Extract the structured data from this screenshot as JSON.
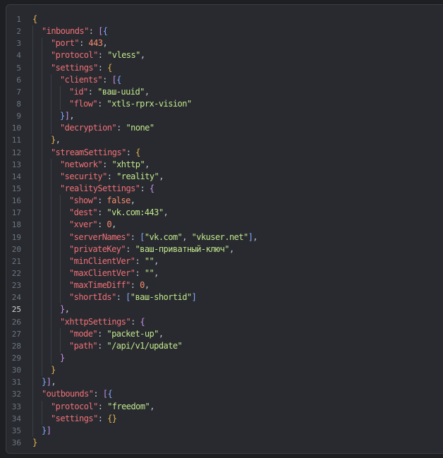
{
  "editor": {
    "language": "json",
    "active_line": 25,
    "colors": {
      "background": "#282a2f",
      "line_number": "#6e7681",
      "key": "#f07178",
      "string": "#c3e88d",
      "number": "#f78c6c",
      "punctuation": "#bfc7d5",
      "bracket_level_0": "#e6b450",
      "bracket_level_1": "#c792ea",
      "bracket_level_2": "#82aaff"
    },
    "lines": [
      {
        "n": "1",
        "indent": 0,
        "tokens": [
          {
            "t": "{",
            "c": "b0"
          }
        ]
      },
      {
        "n": "2",
        "indent": 1,
        "tokens": [
          {
            "t": "\"inbounds\"",
            "c": "key"
          },
          {
            "t": ": ",
            "c": "p"
          },
          {
            "t": "[",
            "c": "b1"
          },
          {
            "t": "{",
            "c": "b2"
          }
        ]
      },
      {
        "n": "3",
        "indent": 2,
        "tokens": [
          {
            "t": "\"port\"",
            "c": "key"
          },
          {
            "t": ": ",
            "c": "p"
          },
          {
            "t": "443",
            "c": "number"
          },
          {
            "t": ",",
            "c": "p"
          }
        ]
      },
      {
        "n": "4",
        "indent": 2,
        "tokens": [
          {
            "t": "\"protocol\"",
            "c": "key"
          },
          {
            "t": ": ",
            "c": "p"
          },
          {
            "t": "\"vless\"",
            "c": "string"
          },
          {
            "t": ",",
            "c": "p"
          }
        ]
      },
      {
        "n": "5",
        "indent": 2,
        "tokens": [
          {
            "t": "\"settings\"",
            "c": "key"
          },
          {
            "t": ": ",
            "c": "p"
          },
          {
            "t": "{",
            "c": "b0"
          }
        ]
      },
      {
        "n": "6",
        "indent": 3,
        "tokens": [
          {
            "t": "\"clients\"",
            "c": "key"
          },
          {
            "t": ": ",
            "c": "p"
          },
          {
            "t": "[",
            "c": "b1"
          },
          {
            "t": "{",
            "c": "b2"
          }
        ]
      },
      {
        "n": "7",
        "indent": 4,
        "tokens": [
          {
            "t": "\"id\"",
            "c": "key"
          },
          {
            "t": ": ",
            "c": "p"
          },
          {
            "t": "\"ваш-uuid\"",
            "c": "string"
          },
          {
            "t": ",",
            "c": "p"
          }
        ]
      },
      {
        "n": "8",
        "indent": 4,
        "tokens": [
          {
            "t": "\"flow\"",
            "c": "key"
          },
          {
            "t": ": ",
            "c": "p"
          },
          {
            "t": "\"xtls-rprx-vision\"",
            "c": "string"
          }
        ]
      },
      {
        "n": "9",
        "indent": 3,
        "tokens": [
          {
            "t": "}",
            "c": "b2"
          },
          {
            "t": "]",
            "c": "b1"
          },
          {
            "t": ",",
            "c": "p"
          }
        ]
      },
      {
        "n": "10",
        "indent": 3,
        "tokens": [
          {
            "t": "\"decryption\"",
            "c": "key"
          },
          {
            "t": ": ",
            "c": "p"
          },
          {
            "t": "\"none\"",
            "c": "string"
          }
        ]
      },
      {
        "n": "11",
        "indent": 2,
        "tokens": [
          {
            "t": "}",
            "c": "b0"
          },
          {
            "t": ",",
            "c": "p"
          }
        ]
      },
      {
        "n": "12",
        "indent": 2,
        "tokens": [
          {
            "t": "\"streamSettings\"",
            "c": "key"
          },
          {
            "t": ": ",
            "c": "p"
          },
          {
            "t": "{",
            "c": "b0"
          }
        ]
      },
      {
        "n": "13",
        "indent": 3,
        "tokens": [
          {
            "t": "\"network\"",
            "c": "key"
          },
          {
            "t": ": ",
            "c": "p"
          },
          {
            "t": "\"xhttp\"",
            "c": "string"
          },
          {
            "t": ",",
            "c": "p"
          }
        ]
      },
      {
        "n": "14",
        "indent": 3,
        "tokens": [
          {
            "t": "\"security\"",
            "c": "key"
          },
          {
            "t": ": ",
            "c": "p"
          },
          {
            "t": "\"reality\"",
            "c": "string"
          },
          {
            "t": ",",
            "c": "p"
          }
        ]
      },
      {
        "n": "15",
        "indent": 3,
        "tokens": [
          {
            "t": "\"realitySettings\"",
            "c": "key"
          },
          {
            "t": ": ",
            "c": "p"
          },
          {
            "t": "{",
            "c": "b1"
          }
        ]
      },
      {
        "n": "16",
        "indent": 4,
        "tokens": [
          {
            "t": "\"show\"",
            "c": "key"
          },
          {
            "t": ": ",
            "c": "p"
          },
          {
            "t": "false",
            "c": "bool"
          },
          {
            "t": ",",
            "c": "p"
          }
        ]
      },
      {
        "n": "17",
        "indent": 4,
        "tokens": [
          {
            "t": "\"dest\"",
            "c": "key"
          },
          {
            "t": ": ",
            "c": "p"
          },
          {
            "t": "\"vk.com:443\"",
            "c": "string"
          },
          {
            "t": ",",
            "c": "p"
          }
        ]
      },
      {
        "n": "18",
        "indent": 4,
        "tokens": [
          {
            "t": "\"xver\"",
            "c": "key"
          },
          {
            "t": ": ",
            "c": "p"
          },
          {
            "t": "0",
            "c": "number"
          },
          {
            "t": ",",
            "c": "p"
          }
        ]
      },
      {
        "n": "19",
        "indent": 4,
        "tokens": [
          {
            "t": "\"serverNames\"",
            "c": "key"
          },
          {
            "t": ": ",
            "c": "p"
          },
          {
            "t": "[",
            "c": "b2"
          },
          {
            "t": "\"vk.com\"",
            "c": "string"
          },
          {
            "t": ", ",
            "c": "p"
          },
          {
            "t": "\"vkuser.net\"",
            "c": "string"
          },
          {
            "t": "]",
            "c": "b2"
          },
          {
            "t": ",",
            "c": "p"
          }
        ]
      },
      {
        "n": "20",
        "indent": 4,
        "tokens": [
          {
            "t": "\"privateKey\"",
            "c": "key"
          },
          {
            "t": ": ",
            "c": "p"
          },
          {
            "t": "\"ваш-приватный-ключ\"",
            "c": "string"
          },
          {
            "t": ",",
            "c": "p"
          }
        ]
      },
      {
        "n": "21",
        "indent": 4,
        "tokens": [
          {
            "t": "\"minClientVer\"",
            "c": "key"
          },
          {
            "t": ": ",
            "c": "p"
          },
          {
            "t": "\"\"",
            "c": "string"
          },
          {
            "t": ",",
            "c": "p"
          }
        ]
      },
      {
        "n": "22",
        "indent": 4,
        "tokens": [
          {
            "t": "\"maxClientVer\"",
            "c": "key"
          },
          {
            "t": ": ",
            "c": "p"
          },
          {
            "t": "\"\"",
            "c": "string"
          },
          {
            "t": ",",
            "c": "p"
          }
        ]
      },
      {
        "n": "23",
        "indent": 4,
        "tokens": [
          {
            "t": "\"maxTimeDiff\"",
            "c": "key"
          },
          {
            "t": ": ",
            "c": "p"
          },
          {
            "t": "0",
            "c": "number"
          },
          {
            "t": ",",
            "c": "p"
          }
        ]
      },
      {
        "n": "24",
        "indent": 4,
        "tokens": [
          {
            "t": "\"shortIds\"",
            "c": "key"
          },
          {
            "t": ": ",
            "c": "p"
          },
          {
            "t": "[",
            "c": "b2"
          },
          {
            "t": "\"ваш-shortid\"",
            "c": "string"
          },
          {
            "t": "]",
            "c": "b2"
          }
        ]
      },
      {
        "n": "25",
        "indent": 3,
        "tokens": [
          {
            "t": "}",
            "c": "b1"
          },
          {
            "t": ",",
            "c": "p"
          }
        ]
      },
      {
        "n": "26",
        "indent": 3,
        "tokens": [
          {
            "t": "\"xhttpSettings\"",
            "c": "key"
          },
          {
            "t": ": ",
            "c": "p"
          },
          {
            "t": "{",
            "c": "b1"
          }
        ]
      },
      {
        "n": "27",
        "indent": 4,
        "tokens": [
          {
            "t": "\"mode\"",
            "c": "key"
          },
          {
            "t": ": ",
            "c": "p"
          },
          {
            "t": "\"packet-up\"",
            "c": "string"
          },
          {
            "t": ",",
            "c": "p"
          }
        ]
      },
      {
        "n": "28",
        "indent": 4,
        "tokens": [
          {
            "t": "\"path\"",
            "c": "key"
          },
          {
            "t": ": ",
            "c": "p"
          },
          {
            "t": "\"/api/v1/update\"",
            "c": "string"
          }
        ]
      },
      {
        "n": "29",
        "indent": 3,
        "tokens": [
          {
            "t": "}",
            "c": "b1"
          }
        ]
      },
      {
        "n": "30",
        "indent": 2,
        "tokens": [
          {
            "t": "}",
            "c": "b0"
          }
        ]
      },
      {
        "n": "31",
        "indent": 1,
        "tokens": [
          {
            "t": "}",
            "c": "b2"
          },
          {
            "t": "]",
            "c": "b1"
          },
          {
            "t": ",",
            "c": "p"
          }
        ]
      },
      {
        "n": "32",
        "indent": 1,
        "tokens": [
          {
            "t": "\"outbounds\"",
            "c": "key"
          },
          {
            "t": ": ",
            "c": "p"
          },
          {
            "t": "[",
            "c": "b1"
          },
          {
            "t": "{",
            "c": "b2"
          }
        ]
      },
      {
        "n": "33",
        "indent": 2,
        "tokens": [
          {
            "t": "\"protocol\"",
            "c": "key"
          },
          {
            "t": ": ",
            "c": "p"
          },
          {
            "t": "\"freedom\"",
            "c": "string"
          },
          {
            "t": ",",
            "c": "p"
          }
        ]
      },
      {
        "n": "34",
        "indent": 2,
        "tokens": [
          {
            "t": "\"settings\"",
            "c": "key"
          },
          {
            "t": ": ",
            "c": "p"
          },
          {
            "t": "{",
            "c": "b0"
          },
          {
            "t": "}",
            "c": "b0"
          }
        ]
      },
      {
        "n": "35",
        "indent": 1,
        "tokens": [
          {
            "t": "}",
            "c": "b2"
          },
          {
            "t": "]",
            "c": "b1"
          }
        ]
      },
      {
        "n": "36",
        "indent": 0,
        "tokens": [
          {
            "t": "}",
            "c": "b0"
          }
        ]
      }
    ]
  }
}
